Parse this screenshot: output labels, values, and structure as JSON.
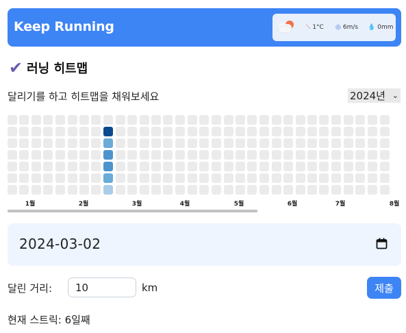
{
  "app": {
    "title": "Keep Running"
  },
  "weather": {
    "icon": "cloud-sun-icon",
    "temperature": "1°C",
    "wind": "6m/s",
    "rain": "0mm"
  },
  "section": {
    "title": "러닝 히트맵",
    "icon": "check-icon"
  },
  "subtitle": "달리기를 하고 히트맵을 채워보세요",
  "year_select": {
    "value": "2024년"
  },
  "heatmap": {
    "rows": 7,
    "visible_weeks": 32,
    "empty_color": "#ebebeb",
    "active_week": 8,
    "active_cells": [
      {
        "day": 1,
        "color": "#0b4a8f"
      },
      {
        "day": 2,
        "color": "#6aabd8"
      },
      {
        "day": 3,
        "color": "#4d94cc"
      },
      {
        "day": 4,
        "color": "#4d94cc"
      },
      {
        "day": 5,
        "color": "#6aabd8"
      },
      {
        "day": 6,
        "color": "#a9cde8"
      }
    ]
  },
  "months": [
    "1월",
    "2월",
    "3월",
    "4월",
    "5월",
    "6월",
    "7월",
    "8월"
  ],
  "date_input": {
    "value": "2024-03-02"
  },
  "distance": {
    "label": "달린 거리:",
    "value": "10",
    "unit": "km"
  },
  "submit_label": "제출",
  "streak": "현재 스트릭: 6일째",
  "colors": {
    "accent": "#3d84f5",
    "check": "#6a5bb0"
  }
}
